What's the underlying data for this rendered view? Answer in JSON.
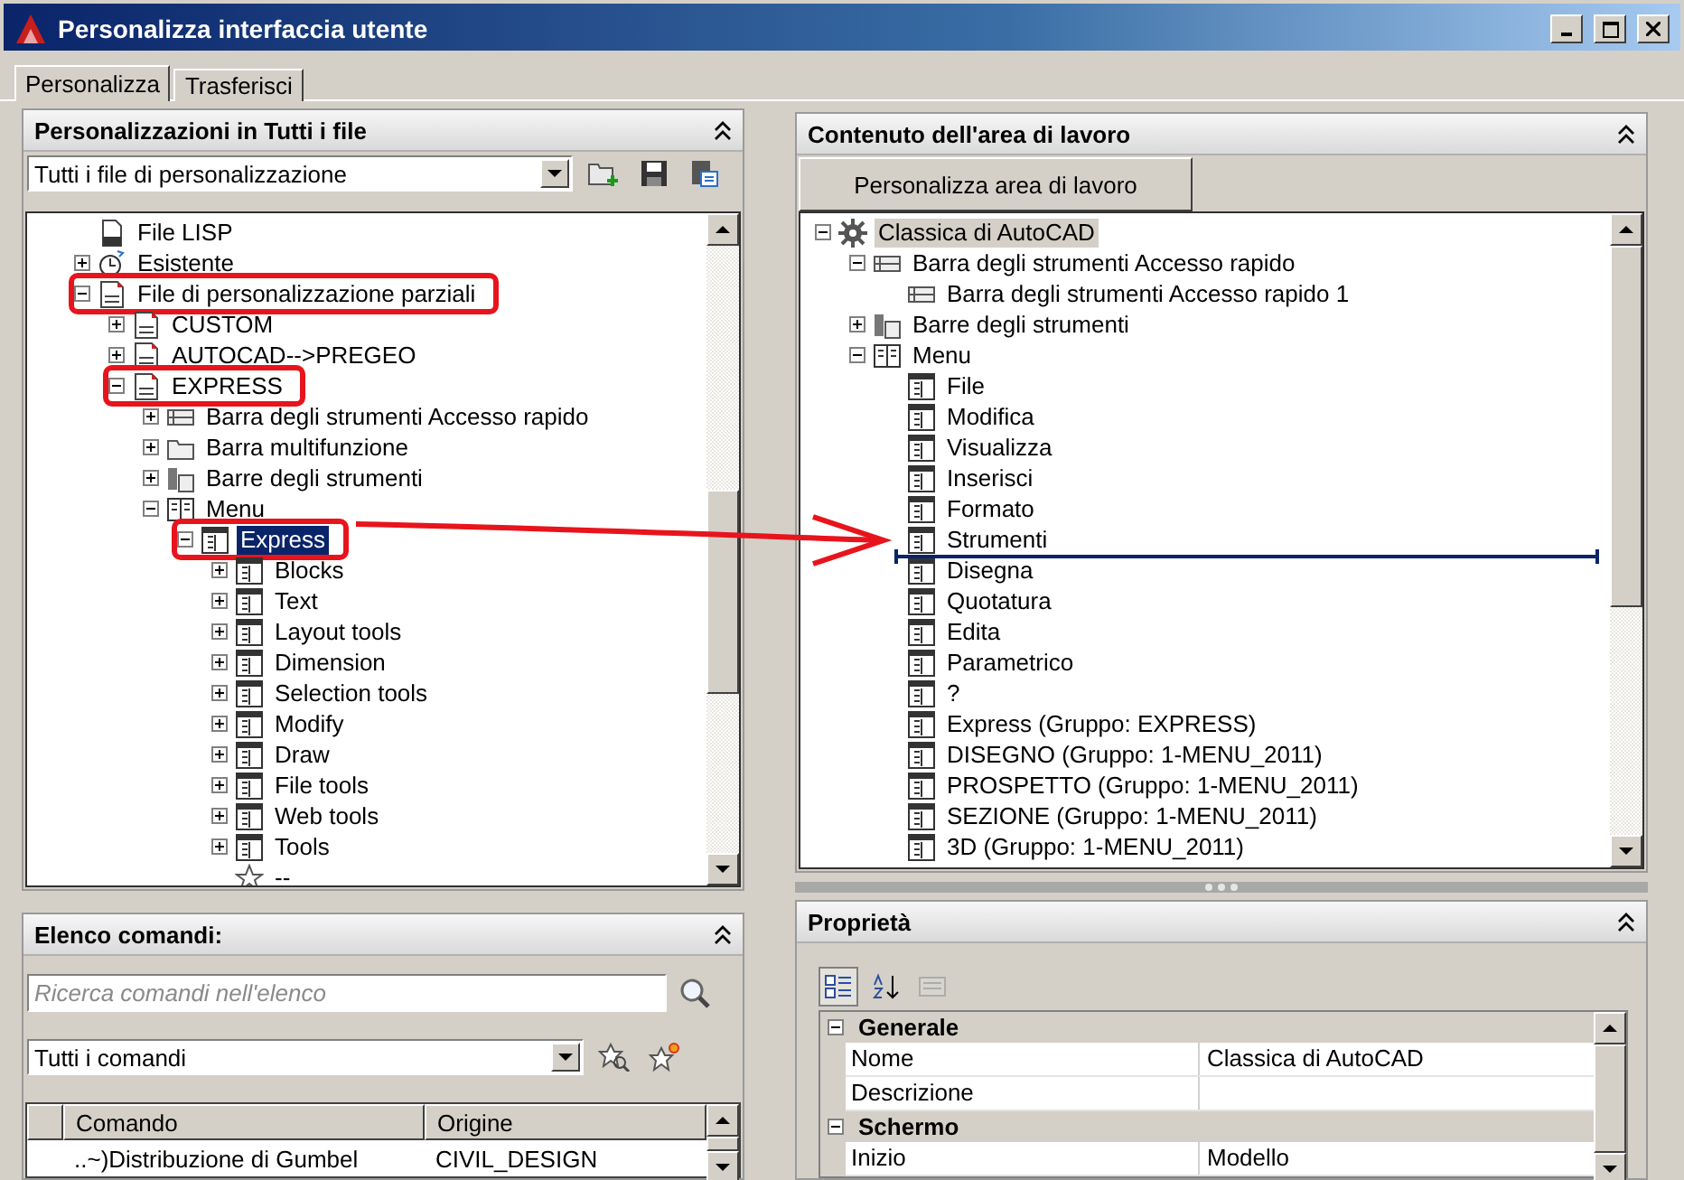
{
  "window": {
    "title": "Personalizza interfaccia utente"
  },
  "tabs": [
    {
      "label": "Personalizza",
      "selected": true
    },
    {
      "label": "Trasferisci",
      "selected": false
    }
  ],
  "customizations_panel": {
    "title": "Personalizzazioni in Tutti i file",
    "expanded": true,
    "file_filter": "Tutti i file di personalizzazione",
    "tree": [
      {
        "label": "File LISP",
        "kind": "lisp",
        "selected": false,
        "highlighted": false
      },
      {
        "label": "Esistente",
        "kind": "history",
        "expanded": false,
        "selected": false,
        "highlighted": false
      },
      {
        "label": "File di personalizzazione parziali",
        "kind": "file",
        "expanded": true,
        "selected": false,
        "highlighted": true,
        "children": [
          {
            "label": "CUSTOM",
            "kind": "file",
            "expanded": false,
            "selected": false,
            "highlighted": false
          },
          {
            "label": "AUTOCAD-->PREGEO",
            "kind": "file",
            "expanded": false,
            "selected": false,
            "highlighted": false
          },
          {
            "label": "EXPRESS",
            "kind": "file",
            "expanded": true,
            "selected": false,
            "highlighted": true,
            "children": [
              {
                "label": "Barra degli strumenti Accesso rapido",
                "kind": "quick_access",
                "expanded": false,
                "selected": false,
                "highlighted": false
              },
              {
                "label": "Barra multifunzione",
                "kind": "ribbon",
                "expanded": false,
                "selected": false,
                "highlighted": false
              },
              {
                "label": "Barre degli strumenti",
                "kind": "toolbars",
                "expanded": false,
                "selected": false,
                "highlighted": false
              },
              {
                "label": "Menu",
                "kind": "menu",
                "expanded": true,
                "selected": false,
                "highlighted": false,
                "children": [
                  {
                    "label": "Express",
                    "kind": "menu_item",
                    "expanded": true,
                    "selected": true,
                    "highlighted": true,
                    "children": [
                      {
                        "label": "Blocks",
                        "kind": "menu_item",
                        "expanded": false,
                        "selected": false,
                        "highlighted": false
                      },
                      {
                        "label": "Text",
                        "kind": "menu_item",
                        "expanded": false,
                        "selected": false,
                        "highlighted": false
                      },
                      {
                        "label": "Layout tools",
                        "kind": "menu_item",
                        "expanded": false,
                        "selected": false,
                        "highlighted": false
                      },
                      {
                        "label": "Dimension",
                        "kind": "menu_item",
                        "expanded": false,
                        "selected": false,
                        "highlighted": false
                      },
                      {
                        "label": "Selection tools",
                        "kind": "menu_item",
                        "expanded": false,
                        "selected": false,
                        "highlighted": false
                      },
                      {
                        "label": "Modify",
                        "kind": "menu_item",
                        "expanded": false,
                        "selected": false,
                        "highlighted": false
                      },
                      {
                        "label": "Draw",
                        "kind": "menu_item",
                        "expanded": false,
                        "selected": false,
                        "highlighted": false
                      },
                      {
                        "label": "File tools",
                        "kind": "menu_item",
                        "expanded": false,
                        "selected": false,
                        "highlighted": false
                      },
                      {
                        "label": "Web tools",
                        "kind": "menu_item",
                        "expanded": false,
                        "selected": false,
                        "highlighted": false
                      },
                      {
                        "label": "Tools",
                        "kind": "menu_item",
                        "expanded": false,
                        "selected": false,
                        "highlighted": false
                      },
                      {
                        "label": "--",
                        "kind": "separator",
                        "selected": false,
                        "highlighted": false
                      }
                    ]
                  }
                ]
              }
            ]
          }
        ]
      }
    ]
  },
  "command_list_panel": {
    "title": "Elenco comandi:",
    "expanded": true,
    "search": {
      "placeholder": "Ricerca comandi nell'elenco"
    },
    "filter": "Tutti i comandi",
    "table": {
      "columns": [
        "Comando",
        "Origine"
      ],
      "rows": [
        [
          "..~)Distribuzione di Gumbel",
          "CIVIL_DESIGN"
        ]
      ]
    }
  },
  "workspace_panel": {
    "title": "Contenuto dell'area di lavoro",
    "expanded": true,
    "button": "Personalizza area di lavoro",
    "tree": [
      {
        "label": "Classica di AutoCAD",
        "kind": "workspace",
        "expanded": true,
        "selected": true,
        "children": [
          {
            "label": "Barra degli strumenti Accesso rapido",
            "kind": "quick_access",
            "expanded": true,
            "selected": false,
            "children": [
              {
                "label": "Barra degli strumenti Accesso rapido 1",
                "kind": "quick_access",
                "selected": false
              }
            ]
          },
          {
            "label": "Barre degli strumenti",
            "kind": "toolbars",
            "expanded": false,
            "selected": false
          },
          {
            "label": "Menu",
            "kind": "menu",
            "expanded": true,
            "selected": false,
            "children": [
              {
                "label": "File",
                "kind": "menu_item",
                "selected": false,
                "drop_indicator": false
              },
              {
                "label": "Modifica",
                "kind": "menu_item",
                "selected": false,
                "drop_indicator": false
              },
              {
                "label": "Visualizza",
                "kind": "menu_item",
                "selected": false,
                "drop_indicator": false
              },
              {
                "label": "Inserisci",
                "kind": "menu_item",
                "selected": false,
                "drop_indicator": false
              },
              {
                "label": "Formato",
                "kind": "menu_item",
                "selected": false,
                "drop_indicator": false
              },
              {
                "label": "Strumenti",
                "kind": "menu_item",
                "selected": false,
                "drop_indicator": true
              },
              {
                "label": "Disegna",
                "kind": "menu_item",
                "selected": false,
                "drop_indicator": false
              },
              {
                "label": "Quotatura",
                "kind": "menu_item",
                "selected": false,
                "drop_indicator": false
              },
              {
                "label": "Edita",
                "kind": "menu_item",
                "selected": false,
                "drop_indicator": false
              },
              {
                "label": "Parametrico",
                "kind": "menu_item",
                "selected": false,
                "drop_indicator": false
              },
              {
                "label": "?",
                "kind": "menu_item",
                "selected": false,
                "drop_indicator": false
              },
              {
                "label": "Express (Gruppo: EXPRESS)",
                "kind": "menu_item",
                "selected": false,
                "drop_indicator": false
              },
              {
                "label": "DISEGNO (Gruppo: 1-MENU_2011)",
                "kind": "menu_item",
                "selected": false,
                "drop_indicator": false
              },
              {
                "label": "PROSPETTO (Gruppo: 1-MENU_2011)",
                "kind": "menu_item",
                "selected": false,
                "drop_indicator": false
              },
              {
                "label": "SEZIONE (Gruppo: 1-MENU_2011)",
                "kind": "menu_item",
                "selected": false,
                "drop_indicator": false
              },
              {
                "label": "3D (Gruppo: 1-MENU_2011)",
                "kind": "menu_item",
                "selected": false,
                "drop_indicator": false
              }
            ]
          }
        ]
      }
    ]
  },
  "properties_panel": {
    "title": "Proprietà",
    "expanded": true,
    "toolbar": [
      {
        "kind": "categorized",
        "selected": true,
        "disabled": false
      },
      {
        "kind": "alphabetical",
        "selected": false,
        "disabled": false
      },
      {
        "kind": "property_pages",
        "selected": false,
        "disabled": true
      }
    ],
    "categories": [
      {
        "name": "Generale",
        "expanded": true,
        "rows": [
          {
            "name": "Nome",
            "value": "Classica di AutoCAD"
          },
          {
            "name": "Descrizione"
          }
        ]
      },
      {
        "name": "Schermo",
        "expanded": true,
        "rows": [
          {
            "name": "Inizio",
            "value": "Modello"
          }
        ]
      }
    ]
  }
}
